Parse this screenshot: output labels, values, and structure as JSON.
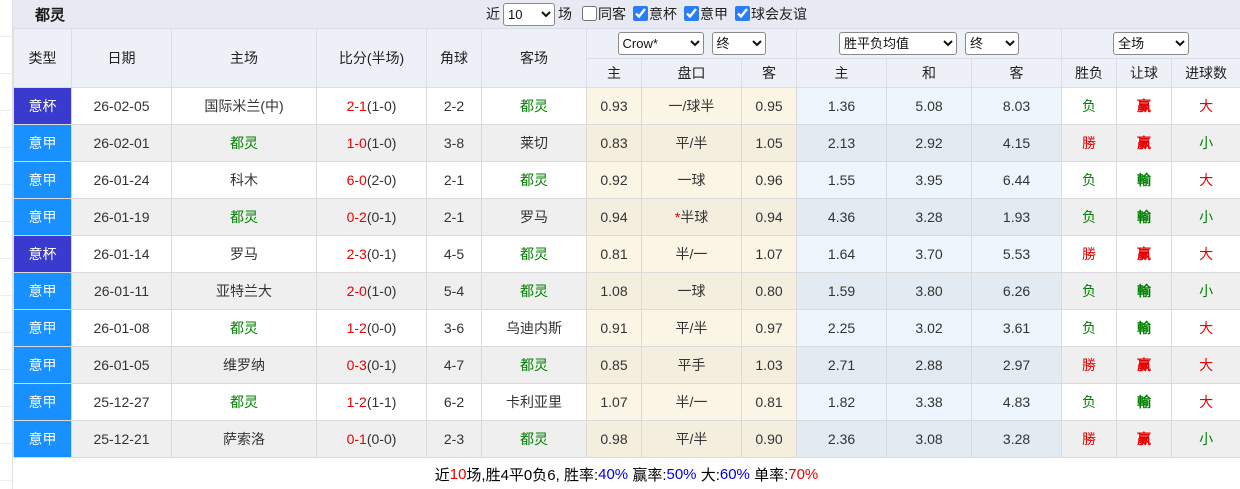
{
  "colors": {
    "badge": {
      "意甲": "#1890ff",
      "意杯": "#3a3ace"
    },
    "red": "#e60000",
    "green": "#008000",
    "blue": "#0000dd",
    "checkbox_accent": "#2b7cf7"
  },
  "title": "都灵",
  "filter_bar": {
    "recent_label": "近",
    "recent_value": "10",
    "games_label": "场",
    "checkboxes": [
      {
        "key": "same-away",
        "label": "同客",
        "checked": false
      },
      {
        "key": "cup",
        "label": "意杯",
        "checked": true
      },
      {
        "key": "league",
        "label": "意甲",
        "checked": true
      },
      {
        "key": "friendly",
        "label": "球会友谊",
        "checked": true
      }
    ]
  },
  "table": {
    "left_headers": [
      "类型",
      "日期",
      "主场",
      "比分(半场)",
      "角球",
      "客场"
    ],
    "selects": {
      "odds_company": "Crow*",
      "odds_time": "终",
      "avg_type": "胜平负均值",
      "avg_time": "终",
      "scope": "全场"
    },
    "sub_headers": [
      "主",
      "盘口",
      "客",
      "主",
      "和",
      "客",
      "胜负",
      "让球",
      "进球数"
    ],
    "rows": [
      {
        "type": "意杯",
        "date": "26-02-05",
        "home": "国际米兰(中)",
        "home_self": false,
        "score": "2-1",
        "half": "(1-0)",
        "corners": "2-2",
        "away": "都灵",
        "away_self": true,
        "odds_home": "0.93",
        "handicap": "一/球半",
        "handicap_star": false,
        "odds_away": "0.95",
        "avg_home": "1.36",
        "avg_draw": "5.08",
        "avg_away": "8.03",
        "result_wdl": "负",
        "result_wdl_color": "green",
        "result_handicap": "赢",
        "result_handicap_color": "red",
        "result_goals": "大",
        "result_goals_color": "red"
      },
      {
        "type": "意甲",
        "date": "26-02-01",
        "home": "都灵",
        "home_self": true,
        "score": "1-0",
        "half": "(1-0)",
        "corners": "3-8",
        "away": "莱切",
        "away_self": false,
        "odds_home": "0.83",
        "handicap": "平/半",
        "handicap_star": false,
        "odds_away": "1.05",
        "avg_home": "2.13",
        "avg_draw": "2.92",
        "avg_away": "4.15",
        "result_wdl": "勝",
        "result_wdl_color": "red",
        "result_handicap": "赢",
        "result_handicap_color": "red",
        "result_goals": "小",
        "result_goals_color": "green"
      },
      {
        "type": "意甲",
        "date": "26-01-24",
        "home": "科木",
        "home_self": false,
        "score": "6-0",
        "half": "(2-0)",
        "corners": "2-1",
        "away": "都灵",
        "away_self": true,
        "odds_home": "0.92",
        "handicap": "一球",
        "handicap_star": false,
        "odds_away": "0.96",
        "avg_home": "1.55",
        "avg_draw": "3.95",
        "avg_away": "6.44",
        "result_wdl": "负",
        "result_wdl_color": "green",
        "result_handicap": "輸",
        "result_handicap_color": "green",
        "result_goals": "大",
        "result_goals_color": "red"
      },
      {
        "type": "意甲",
        "date": "26-01-19",
        "home": "都灵",
        "home_self": true,
        "score": "0-2",
        "half": "(0-1)",
        "corners": "2-1",
        "away": "罗马",
        "away_self": false,
        "odds_home": "0.94",
        "handicap": "半球",
        "handicap_star": true,
        "odds_away": "0.94",
        "avg_home": "4.36",
        "avg_draw": "3.28",
        "avg_away": "1.93",
        "result_wdl": "负",
        "result_wdl_color": "green",
        "result_handicap": "輸",
        "result_handicap_color": "green",
        "result_goals": "小",
        "result_goals_color": "green"
      },
      {
        "type": "意杯",
        "date": "26-01-14",
        "home": "罗马",
        "home_self": false,
        "score": "2-3",
        "half": "(0-1)",
        "corners": "4-5",
        "away": "都灵",
        "away_self": true,
        "odds_home": "0.81",
        "handicap": "半/一",
        "handicap_star": false,
        "odds_away": "1.07",
        "avg_home": "1.64",
        "avg_draw": "3.70",
        "avg_away": "5.53",
        "result_wdl": "勝",
        "result_wdl_color": "red",
        "result_handicap": "赢",
        "result_handicap_color": "red",
        "result_goals": "大",
        "result_goals_color": "red"
      },
      {
        "type": "意甲",
        "date": "26-01-11",
        "home": "亚特兰大",
        "home_self": false,
        "score": "2-0",
        "half": "(1-0)",
        "corners": "5-4",
        "away": "都灵",
        "away_self": true,
        "odds_home": "1.08",
        "handicap": "一球",
        "handicap_star": false,
        "odds_away": "0.80",
        "avg_home": "1.59",
        "avg_draw": "3.80",
        "avg_away": "6.26",
        "result_wdl": "负",
        "result_wdl_color": "green",
        "result_handicap": "輸",
        "result_handicap_color": "green",
        "result_goals": "小",
        "result_goals_color": "green"
      },
      {
        "type": "意甲",
        "date": "26-01-08",
        "home": "都灵",
        "home_self": true,
        "score": "1-2",
        "half": "(0-0)",
        "corners": "3-6",
        "away": "乌迪内斯",
        "away_self": false,
        "odds_home": "0.91",
        "handicap": "平/半",
        "handicap_star": false,
        "odds_away": "0.97",
        "avg_home": "2.25",
        "avg_draw": "3.02",
        "avg_away": "3.61",
        "result_wdl": "负",
        "result_wdl_color": "green",
        "result_handicap": "輸",
        "result_handicap_color": "green",
        "result_goals": "大",
        "result_goals_color": "red"
      },
      {
        "type": "意甲",
        "date": "26-01-05",
        "home": "维罗纳",
        "home_self": false,
        "score": "0-3",
        "half": "(0-1)",
        "corners": "4-7",
        "away": "都灵",
        "away_self": true,
        "odds_home": "0.85",
        "handicap": "平手",
        "handicap_star": false,
        "odds_away": "1.03",
        "avg_home": "2.71",
        "avg_draw": "2.88",
        "avg_away": "2.97",
        "result_wdl": "勝",
        "result_wdl_color": "red",
        "result_handicap": "赢",
        "result_handicap_color": "red",
        "result_goals": "大",
        "result_goals_color": "red"
      },
      {
        "type": "意甲",
        "date": "25-12-27",
        "home": "都灵",
        "home_self": true,
        "score": "1-2",
        "half": "(1-1)",
        "corners": "6-2",
        "away": "卡利亚里",
        "away_self": false,
        "odds_home": "1.07",
        "handicap": "半/一",
        "handicap_star": false,
        "odds_away": "0.81",
        "avg_home": "1.82",
        "avg_draw": "3.38",
        "avg_away": "4.83",
        "result_wdl": "负",
        "result_wdl_color": "green",
        "result_handicap": "輸",
        "result_handicap_color": "green",
        "result_goals": "大",
        "result_goals_color": "red"
      },
      {
        "type": "意甲",
        "date": "25-12-21",
        "home": "萨索洛",
        "home_self": false,
        "score": "0-1",
        "half": "(0-0)",
        "corners": "2-3",
        "away": "都灵",
        "away_self": true,
        "odds_home": "0.98",
        "handicap": "平/半",
        "handicap_star": false,
        "odds_away": "0.90",
        "avg_home": "2.36",
        "avg_draw": "3.08",
        "avg_away": "3.28",
        "result_wdl": "勝",
        "result_wdl_color": "red",
        "result_handicap": "赢",
        "result_handicap_color": "red",
        "result_goals": "小",
        "result_goals_color": "green"
      }
    ]
  },
  "summary": {
    "segments": [
      {
        "text": "近",
        "color": "black"
      },
      {
        "text": "10",
        "color": "red"
      },
      {
        "text": "场,胜4平0负6, 胜率:",
        "color": "black"
      },
      {
        "text": "40%",
        "color": "blue"
      },
      {
        "text": " 赢率:",
        "color": "black"
      },
      {
        "text": "50%",
        "color": "blue"
      },
      {
        "text": " 大:",
        "color": "black"
      },
      {
        "text": "60%",
        "color": "blue"
      },
      {
        "text": " 单率:",
        "color": "black"
      },
      {
        "text": "70%",
        "color": "red"
      }
    ]
  }
}
